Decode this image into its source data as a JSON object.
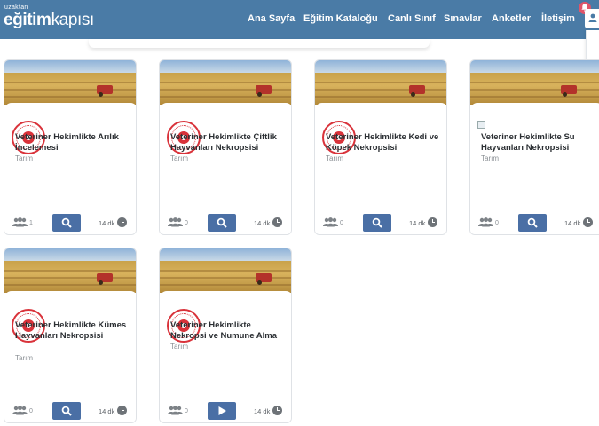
{
  "header": {
    "logo_small": "uzaktan",
    "logo_bold": "eğitim",
    "logo_light": "kapısı",
    "nav": [
      {
        "label": "Ana Sayfa"
      },
      {
        "label": "Eğitim Kataloğu"
      },
      {
        "label": "Canlı Sınıf"
      },
      {
        "label": "Sınavlar"
      },
      {
        "label": "Anketler"
      },
      {
        "label": "İletişim"
      }
    ]
  },
  "courses": [
    {
      "title": "Veteriner Hekimlikte Arılık İncelemesi",
      "category": "Tarım",
      "participants": "1",
      "duration": "14 dk",
      "action": "search"
    },
    {
      "title": "Veteriner Hekimlikte Çiftlik Hayvanları Nekropsisi",
      "category": "Tarım",
      "participants": "0",
      "duration": "14 dk",
      "action": "search"
    },
    {
      "title": "Veteriner Hekimlikte Kedi ve Köpek Nekropsisi",
      "category": "Tarım",
      "participants": "0",
      "duration": "14 dk",
      "action": "search"
    },
    {
      "title": "Veteriner Hekimlikte Su Hayvanları Nekropsisi",
      "category": "Tarım",
      "participants": "0",
      "duration": "14 dk",
      "action": "search"
    },
    {
      "title": "Veteriner Hekimlikte Kümes Hayvanları Nekropsisi",
      "category": "Tarım",
      "participants": "0",
      "duration": "14 dk",
      "action": "search"
    },
    {
      "title": "Veteriner Hekimlikte Nekropsi ve Numune Alma",
      "category": "Tarım",
      "participants": "0",
      "duration": "14 dk",
      "action": "play"
    }
  ],
  "colors": {
    "header_bg": "#4a7ba6",
    "button_bg": "#4a6fa5",
    "seal_red": "#d9323a",
    "bell_bg": "#e0556a"
  },
  "icons": {
    "participants": "users-icon",
    "search": "search-icon",
    "play": "play-icon",
    "duration": "clock-icon",
    "notification": "bell-icon",
    "user": "user-icon"
  }
}
